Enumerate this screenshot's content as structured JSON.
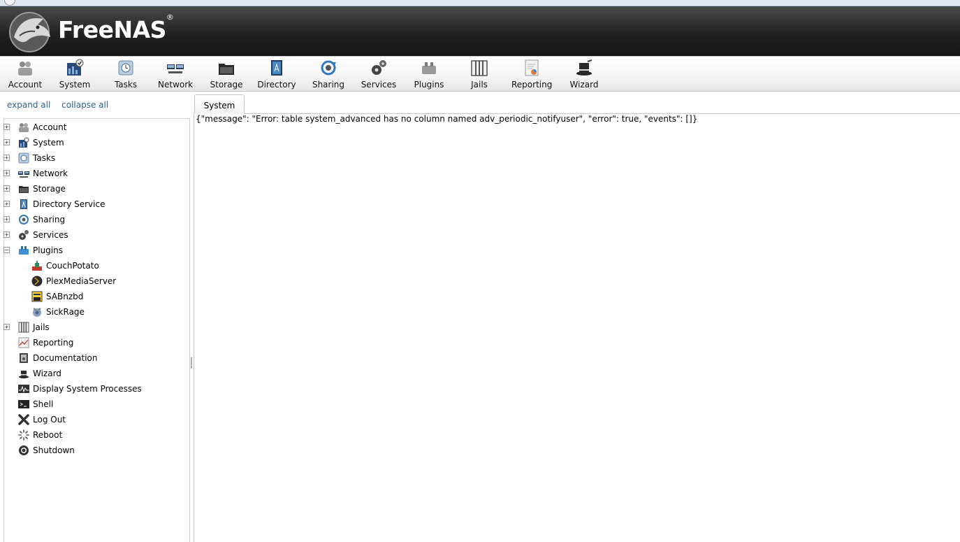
{
  "app": {
    "name": "FreeNAS",
    "trademark": "®"
  },
  "toolbar": {
    "items": [
      {
        "label": "Account",
        "icon": "account-icon"
      },
      {
        "label": "System",
        "icon": "system-icon"
      },
      {
        "label": "Tasks",
        "icon": "tasks-icon"
      },
      {
        "label": "Network",
        "icon": "network-icon"
      },
      {
        "label": "Storage",
        "icon": "storage-icon"
      },
      {
        "label": "Directory",
        "icon": "directory-icon"
      },
      {
        "label": "Sharing",
        "icon": "sharing-icon"
      },
      {
        "label": "Services",
        "icon": "services-icon"
      },
      {
        "label": "Plugins",
        "icon": "plugins-icon"
      },
      {
        "label": "Jails",
        "icon": "jails-icon"
      },
      {
        "label": "Reporting",
        "icon": "reporting-icon"
      },
      {
        "label": "Wizard",
        "icon": "wizard-icon"
      }
    ]
  },
  "sidebar": {
    "expand_all": "expand all",
    "collapse_all": "collapse all",
    "tree": [
      {
        "label": "Account",
        "icon": "account-icon",
        "expander": "+"
      },
      {
        "label": "System",
        "icon": "system-icon",
        "expander": "+"
      },
      {
        "label": "Tasks",
        "icon": "tasks-icon",
        "expander": "+"
      },
      {
        "label": "Network",
        "icon": "network-icon",
        "expander": "+"
      },
      {
        "label": "Storage",
        "icon": "storage-icon",
        "expander": "+"
      },
      {
        "label": "Directory Service",
        "icon": "directory-icon",
        "expander": "+"
      },
      {
        "label": "Sharing",
        "icon": "sharing-icon",
        "expander": "+"
      },
      {
        "label": "Services",
        "icon": "services-icon",
        "expander": "+"
      },
      {
        "label": "Plugins",
        "icon": "plugins-icon",
        "expander": "−"
      },
      {
        "label": "CouchPotato",
        "icon": "couchpotato-icon",
        "expander": ""
      },
      {
        "label": "PlexMediaServer",
        "icon": "plex-icon",
        "expander": ""
      },
      {
        "label": "SABnzbd",
        "icon": "sabnzbd-icon",
        "expander": ""
      },
      {
        "label": "SickRage",
        "icon": "sickrage-icon",
        "expander": ""
      },
      {
        "label": "Jails",
        "icon": "jails-icon",
        "expander": "+"
      },
      {
        "label": "Reporting",
        "icon": "reporting-icon",
        "expander": ""
      },
      {
        "label": "Documentation",
        "icon": "documentation-icon",
        "expander": ""
      },
      {
        "label": "Wizard",
        "icon": "wizard-icon",
        "expander": ""
      },
      {
        "label": "Display System Processes",
        "icon": "processes-icon",
        "expander": ""
      },
      {
        "label": "Shell",
        "icon": "shell-icon",
        "expander": ""
      },
      {
        "label": "Log Out",
        "icon": "logout-icon",
        "expander": ""
      },
      {
        "label": "Reboot",
        "icon": "reboot-icon",
        "expander": ""
      },
      {
        "label": "Shutdown",
        "icon": "shutdown-icon",
        "expander": ""
      }
    ]
  },
  "content": {
    "tab_label": "System",
    "message": "{\"message\": \"Error: table system_advanced has no column named adv_periodic_notifyuser\", \"error\": true, \"events\": []}"
  },
  "colors": {
    "header_dark": "#1f1f1f",
    "link_blue": "#2e5f8e"
  }
}
